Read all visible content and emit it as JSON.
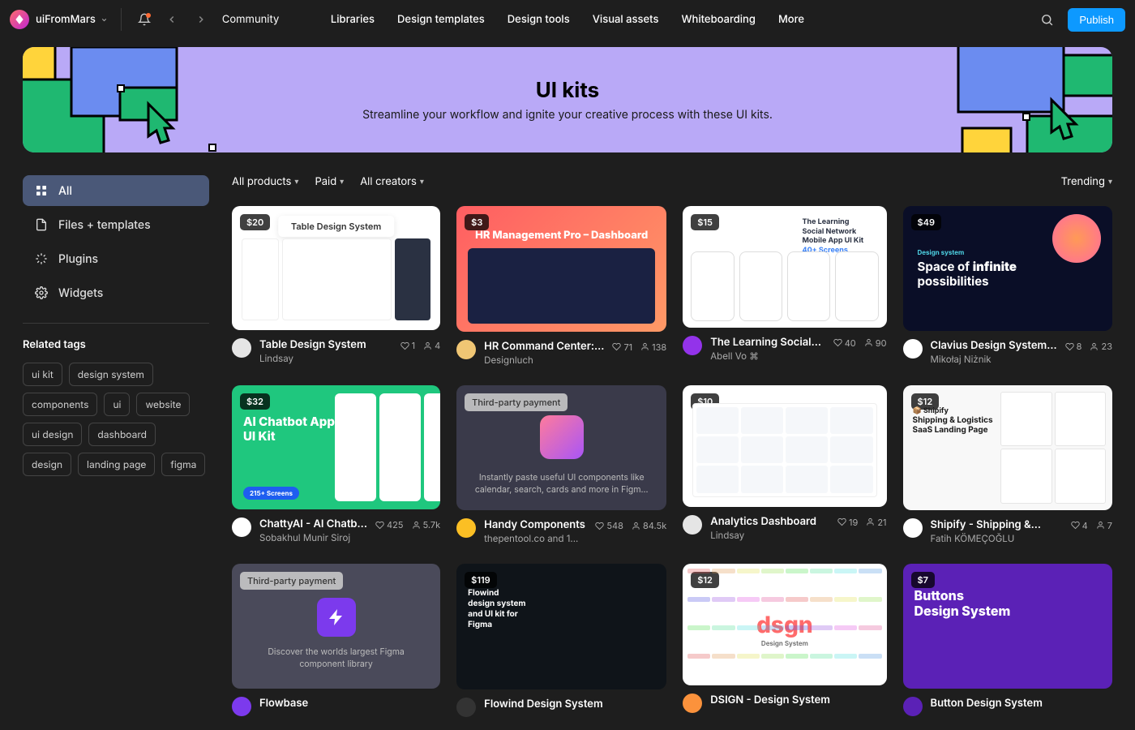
{
  "topbar": {
    "workspace": "uiFromMars",
    "breadcrumb": "Community",
    "nav": [
      "Libraries",
      "Design templates",
      "Design tools",
      "Visual assets",
      "Whiteboarding",
      "More"
    ],
    "publish": "Publish"
  },
  "hero": {
    "title": "UI kits",
    "sub": "Streamline your workflow and ignite your creative process with these UI kits."
  },
  "sidebar": {
    "items": [
      {
        "label": "All",
        "active": true
      },
      {
        "label": "Files + templates",
        "active": false
      },
      {
        "label": "Plugins",
        "active": false
      },
      {
        "label": "Widgets",
        "active": false
      }
    ],
    "related_heading": "Related tags",
    "tags": [
      "ui kit",
      "design system",
      "components",
      "ui",
      "website",
      "ui design",
      "dashboard",
      "design",
      "landing page",
      "figma"
    ]
  },
  "filters": {
    "f1": "All products",
    "f2": "Paid",
    "f3": "All creators",
    "sort": "Trending"
  },
  "cards": [
    {
      "price": "$20",
      "title": "Table Design System",
      "author": "Lindsay",
      "likes": "1",
      "users": "4",
      "thumb": "t1",
      "thumb_label": "Table Design System",
      "avatar_bg": "#e5e5e5"
    },
    {
      "price": "$3",
      "title": "HR Command Center:...",
      "author": "Designluch",
      "likes": "71",
      "users": "138",
      "thumb": "t2",
      "thumb_label": "HR Management Pro – Dashboard",
      "avatar_bg": "#f0c674"
    },
    {
      "price": "$15",
      "title": "The Learning Social...",
      "author": "Abell Vo ⌘",
      "likes": "40",
      "users": "90",
      "thumb": "t3",
      "thumb_label": "The Learning Social Network Mobile App UI Kit",
      "avatar_bg": "#9333ea"
    },
    {
      "price": "$49",
      "title": "Clavius Design System...",
      "author": "Mikołaj Niżnik",
      "likes": "8",
      "users": "23",
      "thumb": "t4",
      "thumb_label": "Space of infinite possibilities",
      "avatar_bg": "#fff"
    },
    {
      "price": "$32",
      "title": "ChattyAI - AI Chatb...",
      "author": "Sobakhul Munir Siroj",
      "likes": "425",
      "users": "5.7k",
      "thumb": "t5",
      "thumb_label": "AI Chatbot App UI Kit",
      "avatar_bg": "#fff"
    },
    {
      "third_party": "Third-party payment",
      "title": "Handy Components",
      "author": "thepentool.co and 1...",
      "likes": "548",
      "users": "84.5k",
      "thumb": "t6",
      "desc": "Instantly paste useful UI components like calendar, search, cards and more in Figm...",
      "avatar_bg": "#fbbf24"
    },
    {
      "price": "$10",
      "title": "Analytics Dashboard",
      "author": "Lindsay",
      "likes": "19",
      "users": "21",
      "thumb": "t7",
      "thumb_label": "",
      "avatar_bg": "#e5e5e5"
    },
    {
      "price": "$12",
      "title": "Shipify - Shipping &...",
      "author": "Fatih KÖMEÇOĞLU",
      "likes": "4",
      "users": "7",
      "thumb": "t8",
      "thumb_label": "Shipping & Logistics SaaS Landing Page",
      "avatar_bg": "#fff"
    },
    {
      "third_party": "Third-party payment",
      "title": "Flowbase",
      "author": "",
      "likes": "",
      "users": "",
      "thumb": "t9",
      "desc": "Discover the worlds largest Figma component library",
      "avatar_bg": "#7c3aed"
    },
    {
      "price": "$119",
      "title": "Flowind Design System",
      "author": "",
      "likes": "",
      "users": "",
      "thumb": "t10",
      "thumb_label": "Flowind design system and UI kit for Figma",
      "avatar_bg": "#333"
    },
    {
      "price": "$12",
      "title": "DSIGN - Design System",
      "author": "",
      "likes": "",
      "users": "",
      "thumb": "t11",
      "thumb_label": "dsgn",
      "avatar_bg": "#fb923c"
    },
    {
      "price": "$7",
      "title": "Button Design System",
      "author": "",
      "likes": "",
      "users": "",
      "thumb": "t12",
      "thumb_label": "Buttons Design System",
      "avatar_bg": "#5b21b6"
    }
  ]
}
